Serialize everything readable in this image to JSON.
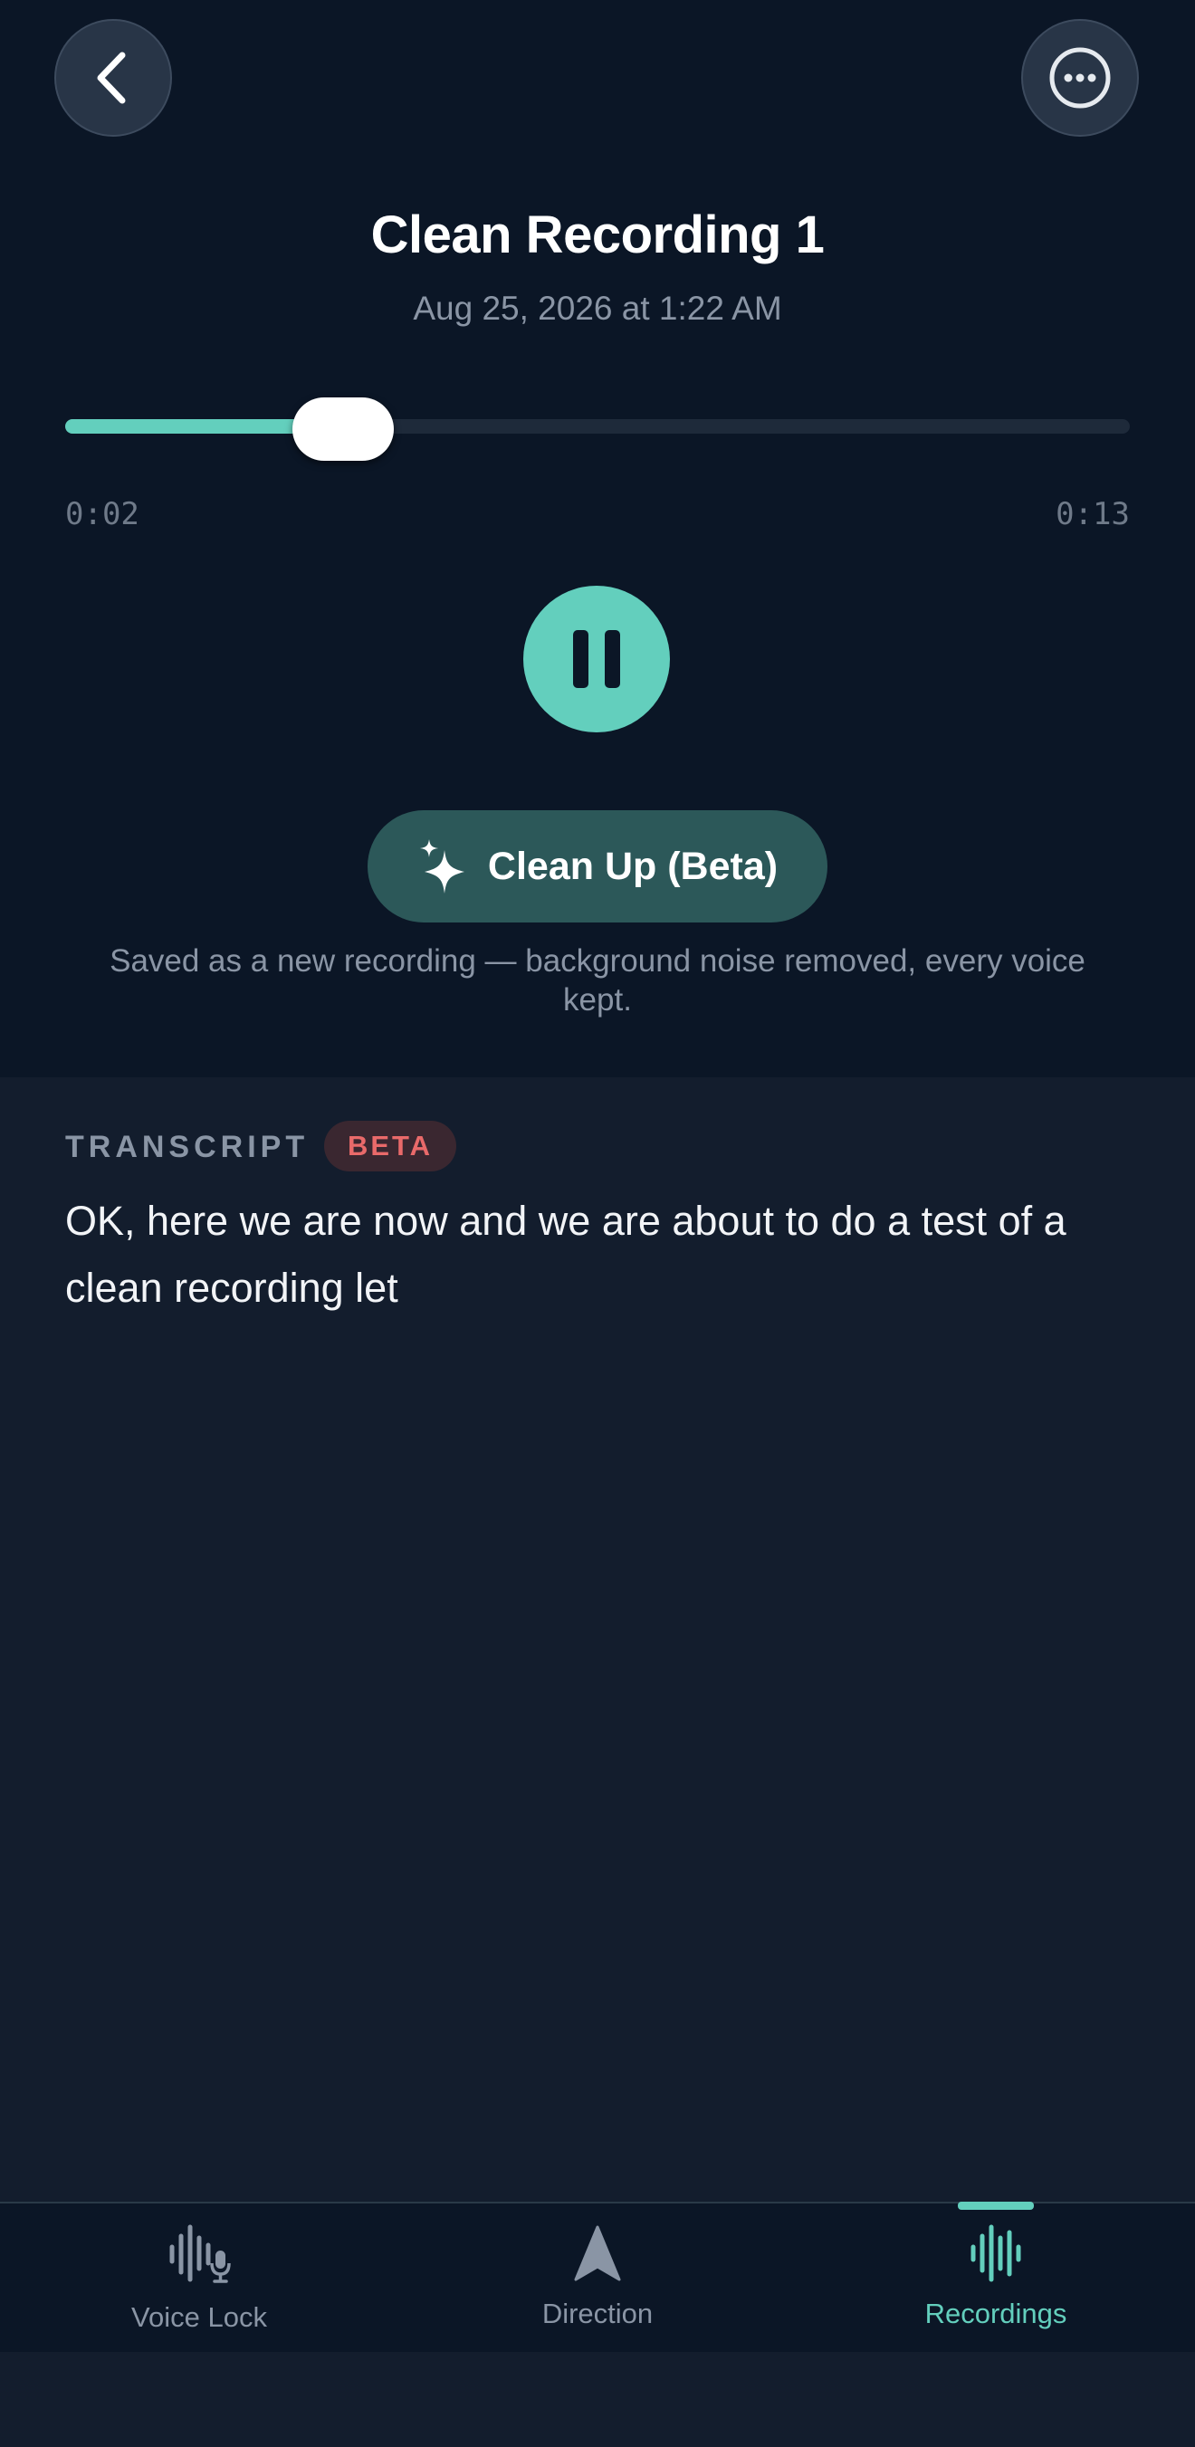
{
  "header": {
    "title": "Clean Recording 1",
    "date": "Aug 25, 2026 at 1:22 AM"
  },
  "player": {
    "elapsed": "0:02",
    "total": "0:13",
    "progress_fraction": 0.17,
    "state": "playing"
  },
  "cleanup": {
    "button_label": "Clean Up (Beta)",
    "note": "Saved as a new recording — background noise removed, every voice kept."
  },
  "transcript": {
    "label": "TRANSCRIPT",
    "badge": "BETA",
    "text": "OK, here we are now and we are about to do a test of a clean recording let"
  },
  "tabs": [
    {
      "label": "Voice Lock",
      "icon": "waveform-mic-icon",
      "active": false
    },
    {
      "label": "Direction",
      "icon": "direction-arrow-icon",
      "active": false
    },
    {
      "label": "Recordings",
      "icon": "waveform-icon",
      "active": true
    }
  ],
  "colors": {
    "accent": "#63cfbd",
    "background_top": "#0b1626",
    "background": "#131d2d",
    "badge_text": "#e96a6a"
  }
}
